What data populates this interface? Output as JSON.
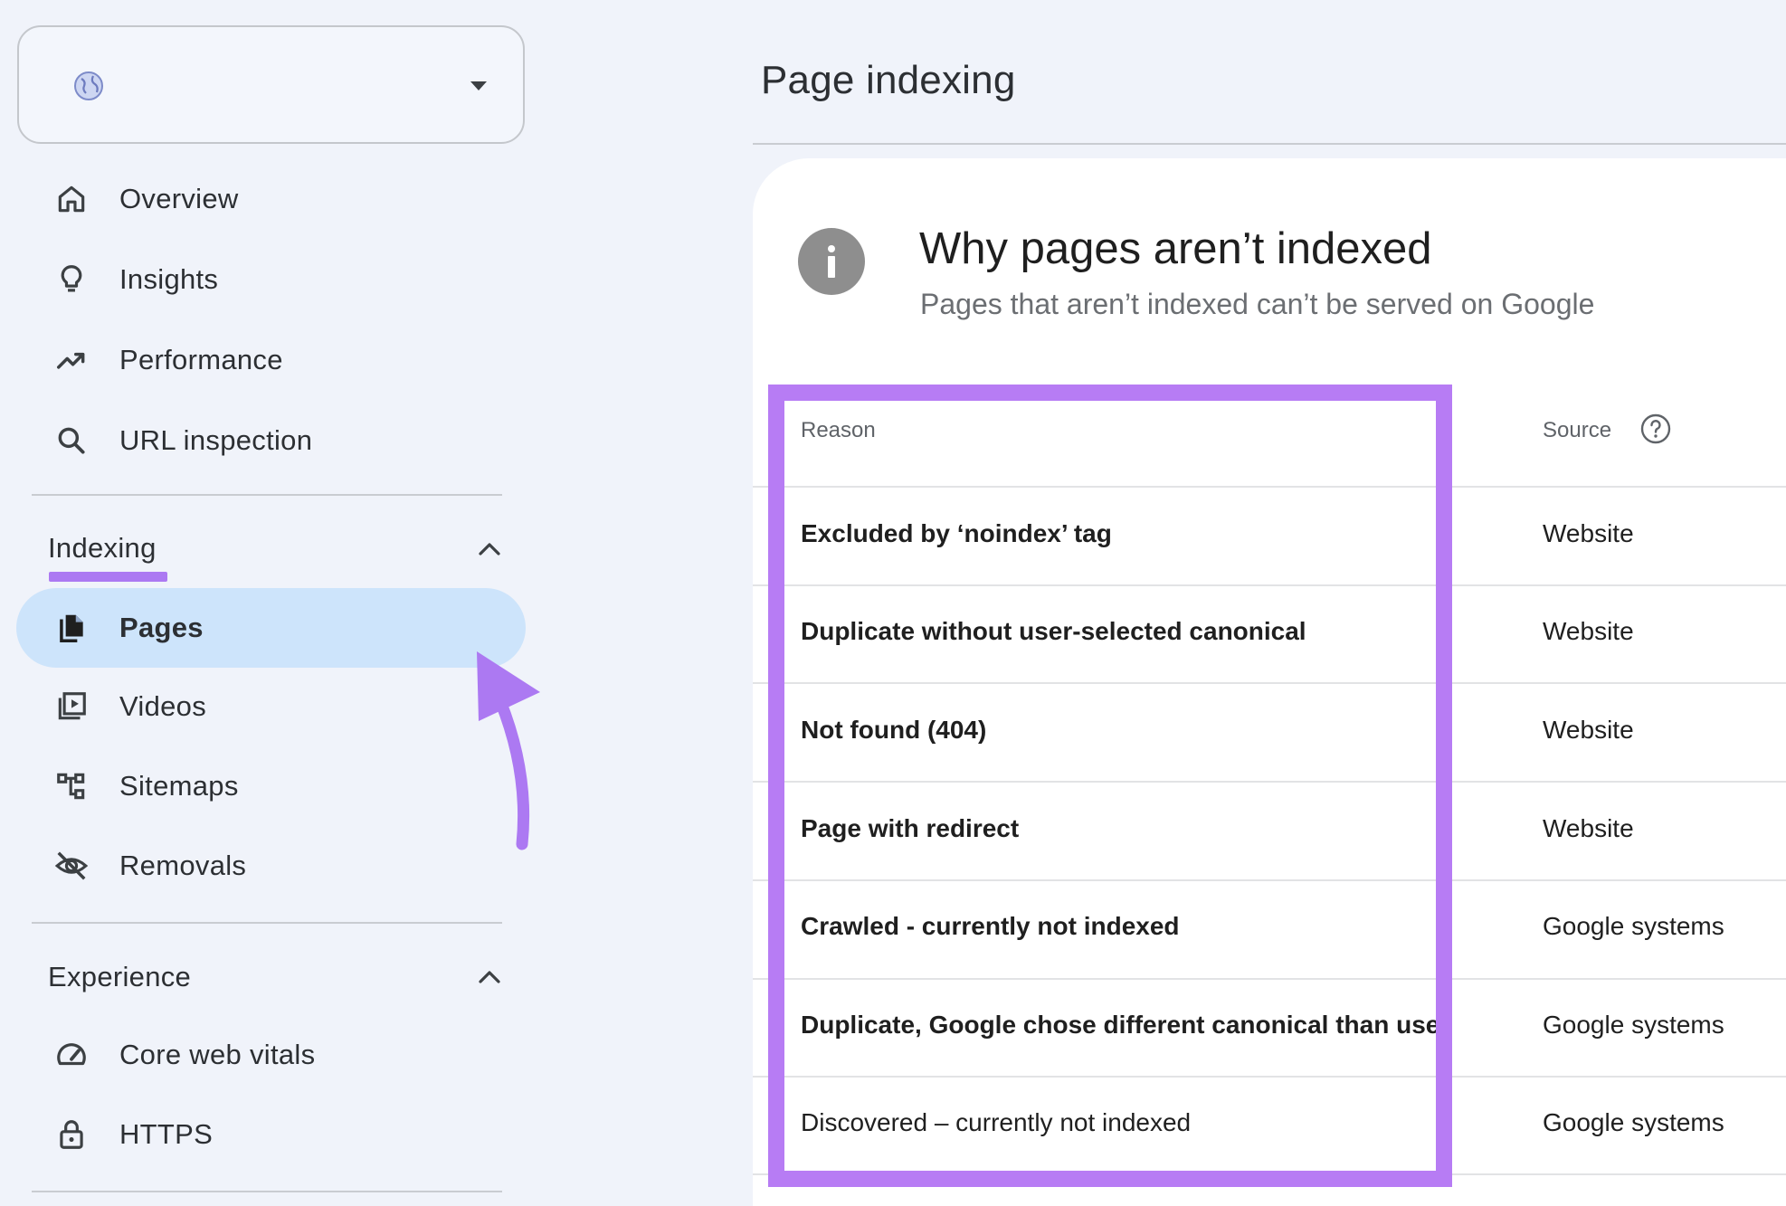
{
  "sidebar": {
    "nav_top": [
      {
        "label": "Overview",
        "icon": "home-icon"
      },
      {
        "label": "Insights",
        "icon": "lightbulb-icon"
      },
      {
        "label": "Performance",
        "icon": "trending-up-icon"
      },
      {
        "label": "URL inspection",
        "icon": "search-icon"
      }
    ],
    "indexing": {
      "heading": "Indexing",
      "items": [
        {
          "label": "Pages",
          "icon": "pages-icon",
          "active": true
        },
        {
          "label": "Videos",
          "icon": "video-library-icon"
        },
        {
          "label": "Sitemaps",
          "icon": "sitemap-icon"
        },
        {
          "label": "Removals",
          "icon": "eye-off-icon"
        }
      ]
    },
    "experience": {
      "heading": "Experience",
      "items": [
        {
          "label": "Core web vitals",
          "icon": "speed-gauge-icon"
        },
        {
          "label": "HTTPS",
          "icon": "lock-icon"
        }
      ]
    }
  },
  "main": {
    "page_title": "Page indexing",
    "card": {
      "title": "Why pages aren’t indexed",
      "subtitle": "Pages that aren’t indexed can’t be served on Google",
      "columns": {
        "reason": "Reason",
        "source": "Source"
      },
      "rows": [
        {
          "reason": "Excluded by ‘noindex’ tag",
          "source": "Website"
        },
        {
          "reason": "Duplicate without user-selected canonical",
          "source": "Website"
        },
        {
          "reason": "Not found (404)",
          "source": "Website"
        },
        {
          "reason": "Page with redirect",
          "source": "Website"
        },
        {
          "reason": "Crawled - currently not indexed",
          "source": "Google systems"
        },
        {
          "reason": "Duplicate, Google chose different canonical than user",
          "source": "Google systems"
        },
        {
          "reason": "Discovered – currently not indexed",
          "source": "Google systems"
        }
      ]
    }
  },
  "colors": {
    "accent_purple": "#b77cf4",
    "active_pill": "#cde4fb",
    "page_bg": "#f0f3fa"
  }
}
